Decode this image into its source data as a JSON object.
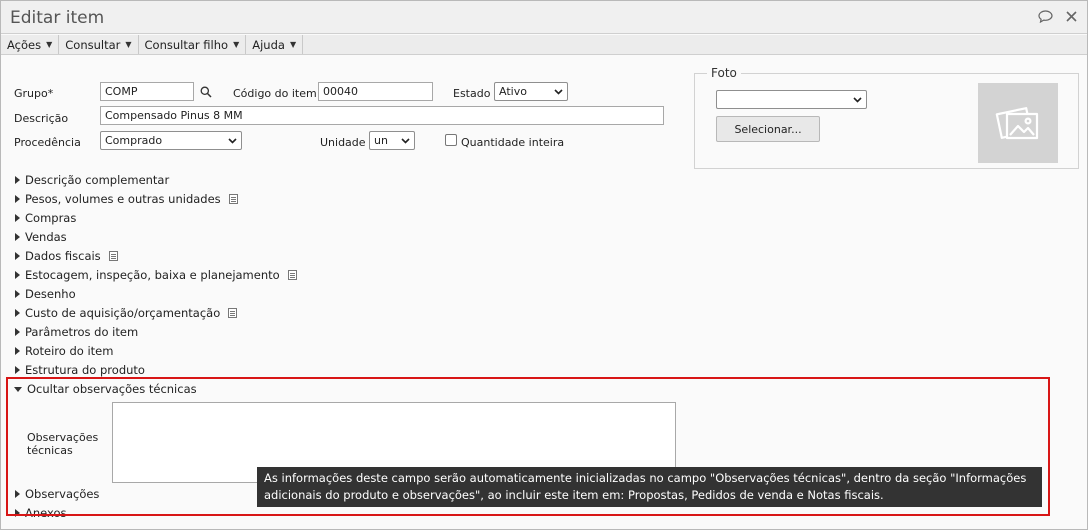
{
  "window": {
    "title": "Editar item",
    "icons": [
      "chat-bubble-icon",
      "close-icon"
    ]
  },
  "menubar": {
    "items": [
      {
        "label": "Ações"
      },
      {
        "label": "Consultar"
      },
      {
        "label": "Consultar filho"
      },
      {
        "label": "Ajuda"
      }
    ]
  },
  "form": {
    "grupo_label": "Grupo*",
    "grupo_value": "COMP",
    "codigo_label": "Código do item",
    "codigo_value": "00040",
    "estado_label": "Estado",
    "estado_value": "Ativo",
    "descricao_label": "Descrição",
    "descricao_value": "Compensado Pinus 8 MM",
    "procedencia_label": "Procedência",
    "procedencia_value": "Comprado",
    "unidade_label": "Unidade",
    "unidade_value": "un",
    "quantidade_inteira_label": "Quantidade inteira",
    "quantidade_inteira_checked": false
  },
  "foto": {
    "legend": "Foto",
    "select_value": "",
    "button_label": "Selecionar..."
  },
  "sections": [
    {
      "label": "Descrição complementar",
      "has_doc_icon": false
    },
    {
      "label": "Pesos, volumes e outras unidades",
      "has_doc_icon": true
    },
    {
      "label": "Compras",
      "has_doc_icon": false
    },
    {
      "label": "Vendas",
      "has_doc_icon": false
    },
    {
      "label": "Dados fiscais",
      "has_doc_icon": true
    },
    {
      "label": "Estocagem, inspeção, baixa e planejamento",
      "has_doc_icon": true
    },
    {
      "label": "Desenho",
      "has_doc_icon": false
    },
    {
      "label": "Custo de aquisição/orçamentação",
      "has_doc_icon": true
    },
    {
      "label": "Parâmetros do item",
      "has_doc_icon": false
    },
    {
      "label": "Roteiro do item",
      "has_doc_icon": false
    },
    {
      "label": "Estrutura do produto",
      "has_doc_icon": false
    }
  ],
  "expanded_section": {
    "label": "Ocultar observações técnicas",
    "field_label": "Observações técnicas",
    "field_value": ""
  },
  "after_sections": [
    {
      "label": "Observações"
    },
    {
      "label": "Anexos"
    }
  ],
  "tooltip": {
    "text": "As informações deste campo serão automaticamente inicializadas no campo \"Observações técnicas\", dentro da seção \"Informações adicionais do produto e observações\", ao incluir este item em: Propostas, Pedidos de venda e Notas fiscais."
  },
  "colors": {
    "highlight": "#d81616",
    "tooltip_bg": "#333333"
  }
}
